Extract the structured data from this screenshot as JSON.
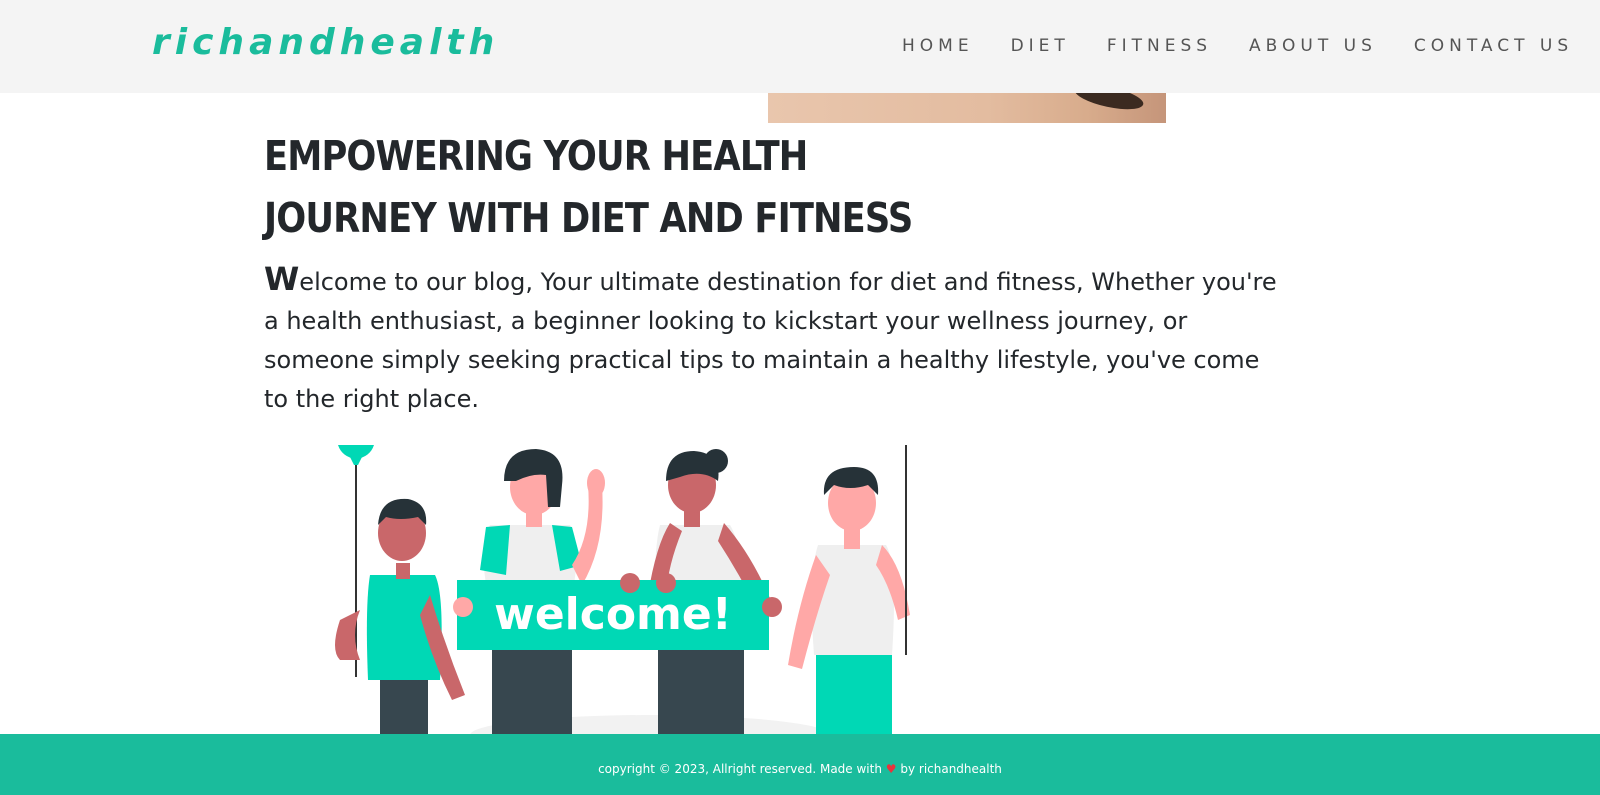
{
  "header": {
    "brand": "richandhealth",
    "nav": [
      "HOME",
      "DIET",
      "FITNESS",
      "ABOUT US",
      "CONTACT US"
    ]
  },
  "hero": {
    "heading_line1": "Empowering your health",
    "heading_line2": "journey with diet and fitness",
    "intro_dropcap": "W",
    "intro_text": "elcome to our blog, Your ultimate destination for diet and fitness, Whether you're a health enthusiast, a beginner looking to kickstart your wellness journey, or someone simply seeking practical tips to maintain a healthy lifestyle, you've come to the right place."
  },
  "illustration": {
    "banner_text": "welcome!"
  },
  "footer": {
    "text_before": "copyright © 2023, Allright reserved. Made with ",
    "heart": "♥",
    "text_after": " by richandhealth"
  },
  "colors": {
    "brand": "#1abc9c",
    "navbar_bg": "#f4f4f4",
    "text": "#23272b",
    "teal_banner": "#00d8b5"
  }
}
